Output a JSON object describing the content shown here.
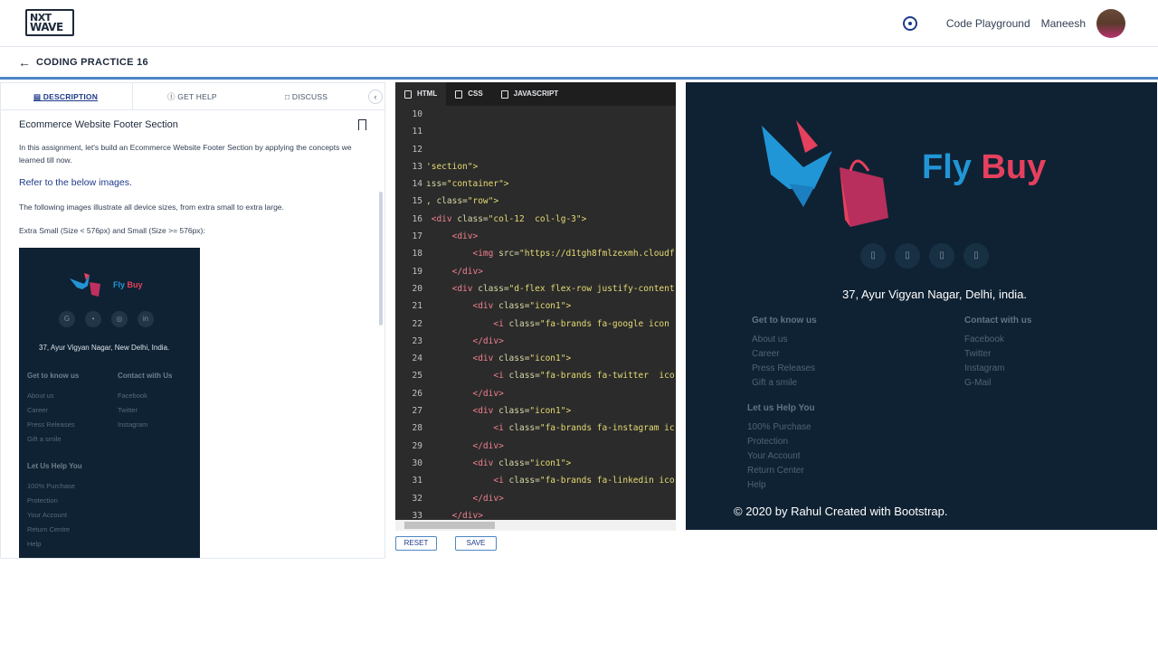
{
  "header": {
    "logo_line1": "NXT",
    "logo_line2": "WAVE",
    "code_playground": "Code Playground",
    "user_name": "Maneesh"
  },
  "subheader": {
    "back_icon": "arrow-left-icon",
    "title": "CODING PRACTICE 16"
  },
  "left_tabs": {
    "description": "DESCRIPTION",
    "get_help": "GET HELP",
    "discuss": "DISCUSS"
  },
  "description": {
    "title": "Ecommerce Website Footer Section",
    "intro": "In this assignment, let's build an Ecommerce Website Footer Section by applying the concepts we learned till now.",
    "refer": "Refer to the below images.",
    "illustrate": "The following images illustrate all device sizes, from extra small to extra large.",
    "sizes": "Extra Small (Size < 576px) and Small (Size >= 576px):"
  },
  "mini_preview": {
    "fly": "Fly",
    "buy": "Buy",
    "icons": [
      "G",
      "•",
      "◎",
      "in"
    ],
    "address": "37, Ayur Vigyan Nagar, New Delhi, India.",
    "col1_heading": "Get to know us",
    "col1_links": [
      "About us",
      "Career",
      "Press Releases",
      "Gift a smile"
    ],
    "col2_heading": "Contact with Us",
    "col2_links": [
      "Facebook",
      "Twitter",
      "Instagram"
    ],
    "col3_heading": "Let Us Help You",
    "col3_links": [
      "100% Purchase",
      "Protection",
      "Your Account",
      "Return Centre",
      "Help"
    ]
  },
  "editor": {
    "tabs": [
      "HTML",
      "CSS",
      "JAVASCRIPT"
    ],
    "line_numbers": [
      "10",
      "11",
      "12",
      "13",
      "14",
      "15",
      "16",
      "17",
      "18",
      "19",
      "20",
      "21",
      "22",
      "23",
      "24",
      "25",
      "26",
      "27",
      "28",
      "29",
      "30",
      "31",
      "32",
      "33"
    ],
    "reset": "RESET",
    "save": "SAVE"
  },
  "preview": {
    "fly": "Fly",
    "buy": "Buy",
    "icon_glyphs": [
      "▯",
      "▯",
      "▯",
      "▯"
    ],
    "address": "37, Ayur Vigyan Nagar, Delhi, india.",
    "col1_heading": "Get to know us",
    "col1_links": [
      "About us",
      "Career",
      "Press Releases",
      "Gift a smile"
    ],
    "col2_heading": "Contact with us",
    "col2_links": [
      "Facebook",
      "Twitter",
      "Instagram",
      "G-Mail"
    ],
    "col3_heading": "Let us Help You",
    "col3_links": [
      "100% Purchase",
      "Protection",
      "Your Account",
      "Return Center",
      "Help"
    ],
    "copyright": "© 2020 by Rahul Created with Bootstrap."
  },
  "colors": {
    "footer_bg": "#0f2233",
    "fly": "#2196d7",
    "buy": "#e5405e",
    "accent": "#4f86c6"
  }
}
